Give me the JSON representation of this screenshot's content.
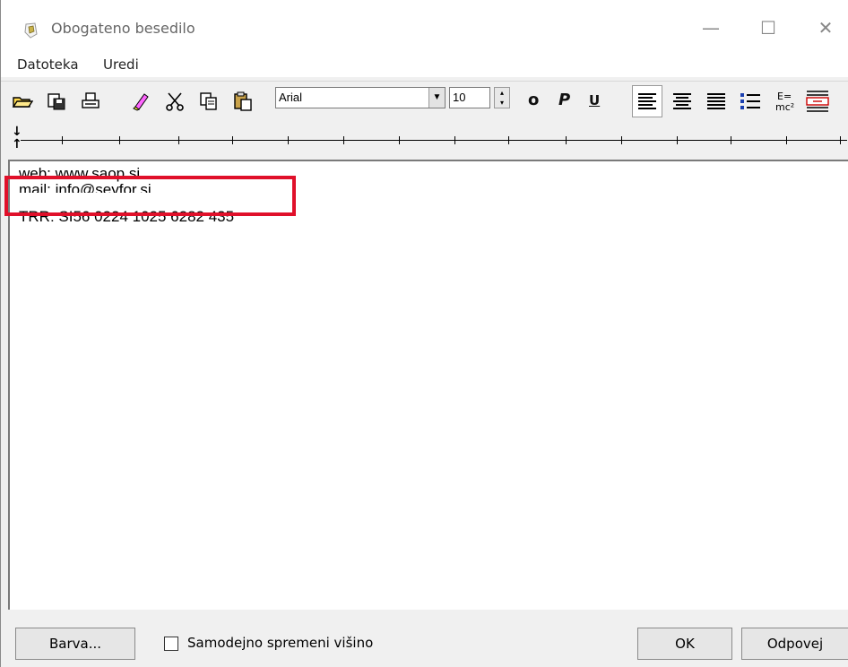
{
  "window": {
    "title": "Obogateno besedilo",
    "controls": {
      "minimize": "—",
      "maximize": "☐",
      "close": "✕"
    }
  },
  "menu": {
    "items": [
      "Datoteka",
      "Uredi"
    ]
  },
  "toolbar": {
    "icons": [
      "open-icon",
      "save-icon",
      "print-icon",
      "eraser-icon",
      "cut-icon",
      "copy-icon",
      "paste-icon"
    ],
    "font_name": "Arial",
    "font_size": "10",
    "bold_label": "o",
    "italic_label": "P",
    "underline_label": "U",
    "align_icons": [
      "align-left-icon",
      "align-center-icon",
      "align-right-icon",
      "bullet-list-icon",
      "equation-icon",
      "insert-table-icon"
    ]
  },
  "editor": {
    "lines": [
      "web: www.saop.si",
      "mail: info@seyfor.si",
      "TRR: SI56 0224 1025 6282 435"
    ],
    "highlight_color": "#e0102a"
  },
  "footer": {
    "color_button": "Barva...",
    "auto_height_label": "Samodejno spremeni višino",
    "auto_height_checked": false,
    "ok_button": "OK",
    "cancel_button": "Odpovej"
  }
}
